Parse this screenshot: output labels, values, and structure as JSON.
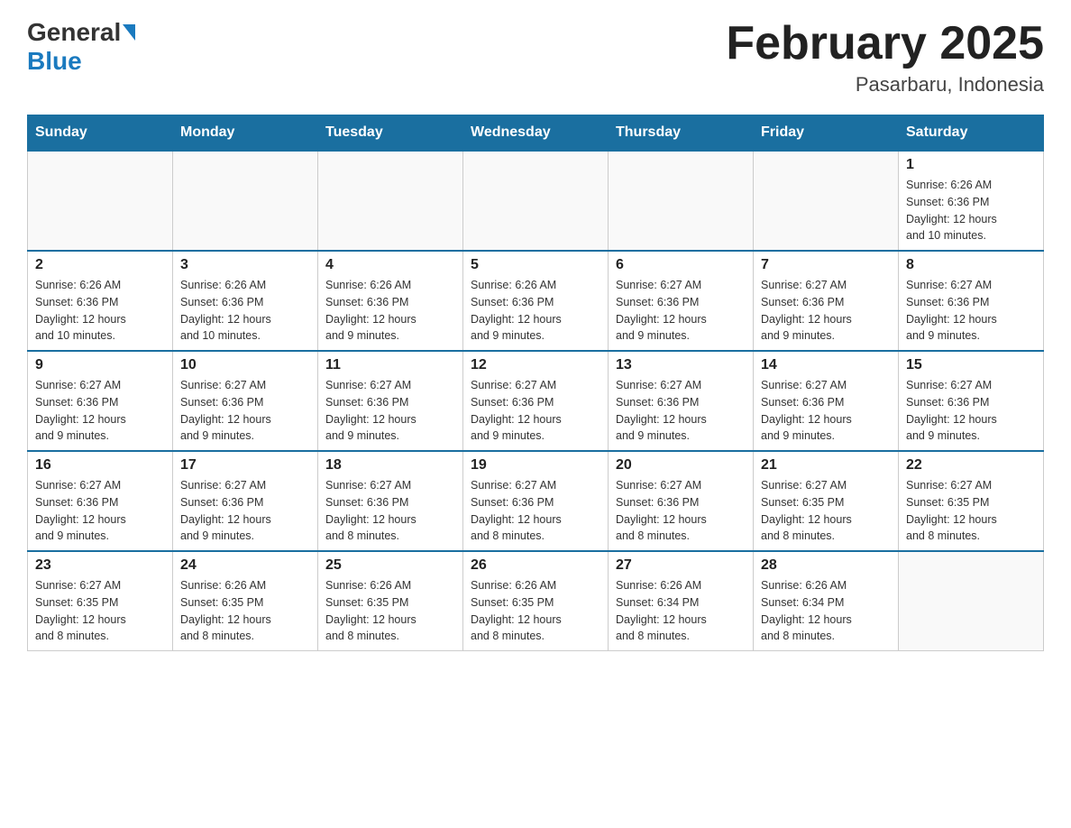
{
  "header": {
    "logo_general": "General",
    "logo_blue": "Blue",
    "month_title": "February 2025",
    "location": "Pasarbaru, Indonesia"
  },
  "days_of_week": [
    "Sunday",
    "Monday",
    "Tuesday",
    "Wednesday",
    "Thursday",
    "Friday",
    "Saturday"
  ],
  "weeks": [
    [
      {
        "day": "",
        "info": ""
      },
      {
        "day": "",
        "info": ""
      },
      {
        "day": "",
        "info": ""
      },
      {
        "day": "",
        "info": ""
      },
      {
        "day": "",
        "info": ""
      },
      {
        "day": "",
        "info": ""
      },
      {
        "day": "1",
        "info": "Sunrise: 6:26 AM\nSunset: 6:36 PM\nDaylight: 12 hours\nand 10 minutes."
      }
    ],
    [
      {
        "day": "2",
        "info": "Sunrise: 6:26 AM\nSunset: 6:36 PM\nDaylight: 12 hours\nand 10 minutes."
      },
      {
        "day": "3",
        "info": "Sunrise: 6:26 AM\nSunset: 6:36 PM\nDaylight: 12 hours\nand 10 minutes."
      },
      {
        "day": "4",
        "info": "Sunrise: 6:26 AM\nSunset: 6:36 PM\nDaylight: 12 hours\nand 9 minutes."
      },
      {
        "day": "5",
        "info": "Sunrise: 6:26 AM\nSunset: 6:36 PM\nDaylight: 12 hours\nand 9 minutes."
      },
      {
        "day": "6",
        "info": "Sunrise: 6:27 AM\nSunset: 6:36 PM\nDaylight: 12 hours\nand 9 minutes."
      },
      {
        "day": "7",
        "info": "Sunrise: 6:27 AM\nSunset: 6:36 PM\nDaylight: 12 hours\nand 9 minutes."
      },
      {
        "day": "8",
        "info": "Sunrise: 6:27 AM\nSunset: 6:36 PM\nDaylight: 12 hours\nand 9 minutes."
      }
    ],
    [
      {
        "day": "9",
        "info": "Sunrise: 6:27 AM\nSunset: 6:36 PM\nDaylight: 12 hours\nand 9 minutes."
      },
      {
        "day": "10",
        "info": "Sunrise: 6:27 AM\nSunset: 6:36 PM\nDaylight: 12 hours\nand 9 minutes."
      },
      {
        "day": "11",
        "info": "Sunrise: 6:27 AM\nSunset: 6:36 PM\nDaylight: 12 hours\nand 9 minutes."
      },
      {
        "day": "12",
        "info": "Sunrise: 6:27 AM\nSunset: 6:36 PM\nDaylight: 12 hours\nand 9 minutes."
      },
      {
        "day": "13",
        "info": "Sunrise: 6:27 AM\nSunset: 6:36 PM\nDaylight: 12 hours\nand 9 minutes."
      },
      {
        "day": "14",
        "info": "Sunrise: 6:27 AM\nSunset: 6:36 PM\nDaylight: 12 hours\nand 9 minutes."
      },
      {
        "day": "15",
        "info": "Sunrise: 6:27 AM\nSunset: 6:36 PM\nDaylight: 12 hours\nand 9 minutes."
      }
    ],
    [
      {
        "day": "16",
        "info": "Sunrise: 6:27 AM\nSunset: 6:36 PM\nDaylight: 12 hours\nand 9 minutes."
      },
      {
        "day": "17",
        "info": "Sunrise: 6:27 AM\nSunset: 6:36 PM\nDaylight: 12 hours\nand 9 minutes."
      },
      {
        "day": "18",
        "info": "Sunrise: 6:27 AM\nSunset: 6:36 PM\nDaylight: 12 hours\nand 8 minutes."
      },
      {
        "day": "19",
        "info": "Sunrise: 6:27 AM\nSunset: 6:36 PM\nDaylight: 12 hours\nand 8 minutes."
      },
      {
        "day": "20",
        "info": "Sunrise: 6:27 AM\nSunset: 6:36 PM\nDaylight: 12 hours\nand 8 minutes."
      },
      {
        "day": "21",
        "info": "Sunrise: 6:27 AM\nSunset: 6:35 PM\nDaylight: 12 hours\nand 8 minutes."
      },
      {
        "day": "22",
        "info": "Sunrise: 6:27 AM\nSunset: 6:35 PM\nDaylight: 12 hours\nand 8 minutes."
      }
    ],
    [
      {
        "day": "23",
        "info": "Sunrise: 6:27 AM\nSunset: 6:35 PM\nDaylight: 12 hours\nand 8 minutes."
      },
      {
        "day": "24",
        "info": "Sunrise: 6:26 AM\nSunset: 6:35 PM\nDaylight: 12 hours\nand 8 minutes."
      },
      {
        "day": "25",
        "info": "Sunrise: 6:26 AM\nSunset: 6:35 PM\nDaylight: 12 hours\nand 8 minutes."
      },
      {
        "day": "26",
        "info": "Sunrise: 6:26 AM\nSunset: 6:35 PM\nDaylight: 12 hours\nand 8 minutes."
      },
      {
        "day": "27",
        "info": "Sunrise: 6:26 AM\nSunset: 6:34 PM\nDaylight: 12 hours\nand 8 minutes."
      },
      {
        "day": "28",
        "info": "Sunrise: 6:26 AM\nSunset: 6:34 PM\nDaylight: 12 hours\nand 8 minutes."
      },
      {
        "day": "",
        "info": ""
      }
    ]
  ]
}
